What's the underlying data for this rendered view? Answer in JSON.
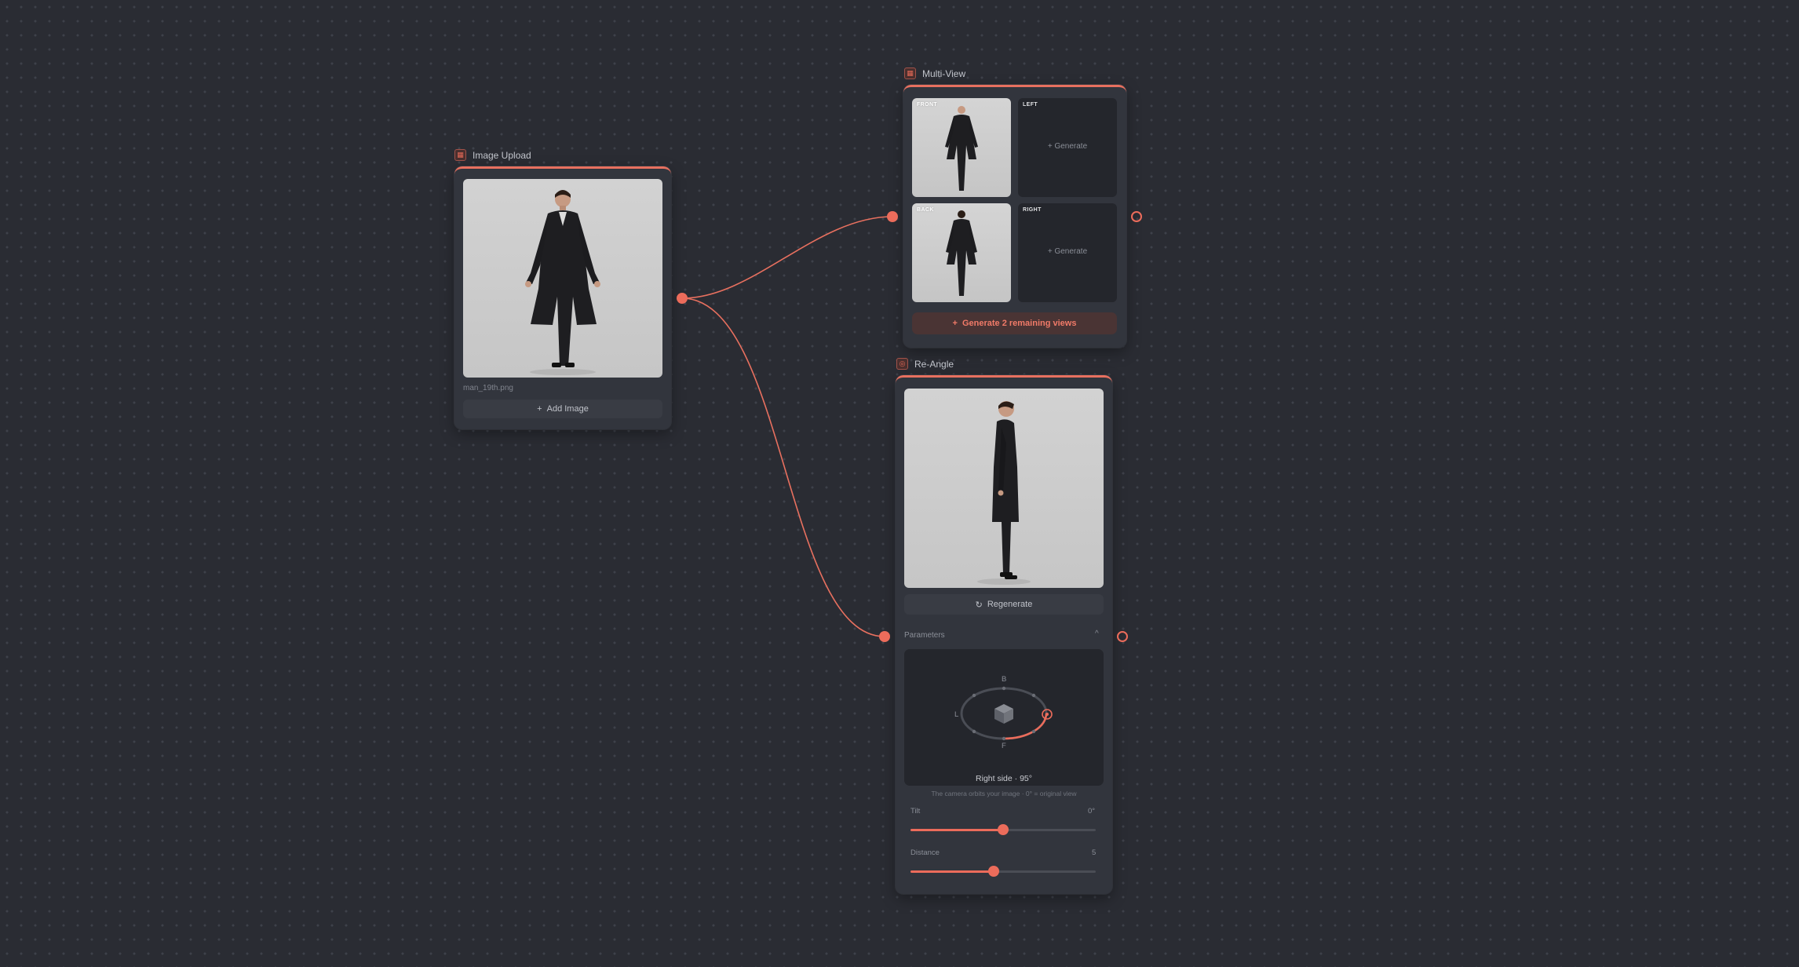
{
  "colors": {
    "background": "#2a2c33",
    "node": "#32353d",
    "accent": "#ec6c5b",
    "accent_soft": "#4a3434"
  },
  "image_upload": {
    "title": "Image Upload",
    "icon": "image-icon",
    "filename": "man_19th.png",
    "add_label": "Add Image"
  },
  "multi_view": {
    "title": "Multi-View",
    "icon": "grid-icon",
    "views": [
      {
        "label": "FRONT",
        "state": "generated"
      },
      {
        "label": "LEFT",
        "state": "empty",
        "action": "Generate"
      },
      {
        "label": "BACK",
        "state": "generated"
      },
      {
        "label": "RIGHT",
        "state": "empty",
        "action": "Generate"
      }
    ],
    "generate_all_label": "Generate 2 remaining views"
  },
  "re_angle": {
    "title": "Re-Angle",
    "icon": "camera-icon",
    "regenerate_label": "Regenerate",
    "params_label": "Parameters",
    "orbit": {
      "marker_back": "B",
      "marker_front": "F",
      "marker_left": "L",
      "angle_label": "Right side · 95°",
      "hint": "The camera orbits your image · 0° = original view"
    },
    "tilt": {
      "label": "Tilt",
      "value_text": "0°",
      "fraction": 0.5
    },
    "distance": {
      "label": "Distance",
      "value_text": "5",
      "fraction": 0.45
    }
  }
}
